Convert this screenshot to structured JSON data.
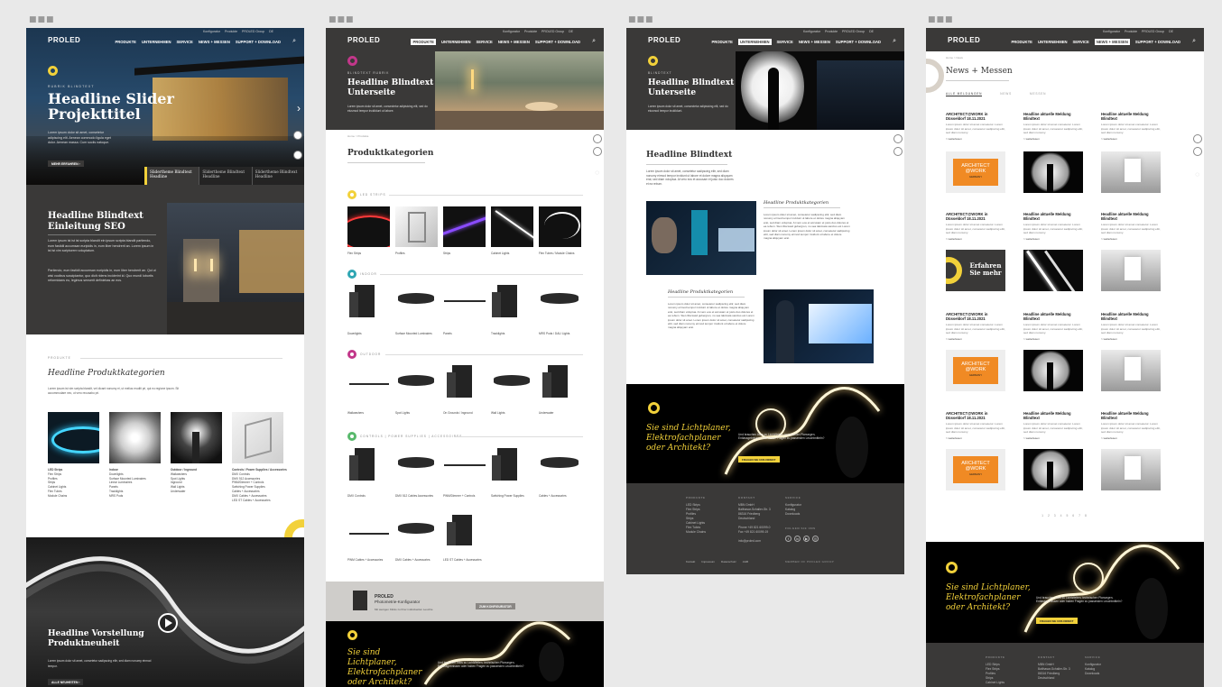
{
  "nav": {
    "logo": "PROLED",
    "util": [
      "Konfigurator",
      "Produkte",
      "PROLED Group",
      "DE"
    ],
    "menu": [
      "Produkte",
      "Unternehmen",
      "Service",
      "News + Messen",
      "Support + Download"
    ]
  },
  "p1": {
    "kicker": "RUBRIK BLINDTEXT",
    "hero_title": "Headline Slider Projekttitel",
    "hero_text": "Lorem ipsum dolor sit amet, consetetur adipiscing elit. Aenean commodo ligula eget dolor. Aenean massa. Cum sociis natoque.",
    "hero_btn": "MEHR ERFAHREN",
    "slider_tabs": [
      "Slidertheme Blindtext Headline",
      "Slidertheme Blindtext Headline",
      "Slidertheme Blindtext Headline"
    ],
    "seo_title": "Headline Blindtext Einleitung SEO",
    "seo_text1": "Lorem ipsum ist ist ist scripta blandit ein ipsum scripta blandit partiendo, eum fastidii accumsan euripidis in, eum liber hendrerit an. Lorem ipsum in ist ist vim scriptorem voluptatum.",
    "seo_text2": "Partiendo, eum fastidii accumsan euripidis in, eum liber hendrerit an. Qui ut wisi vocibus suscipiantur, quo dicit ridens inciderint id. Quo mundi lobortis reformidans eu, legimus senserit definiebas an eos.",
    "prod_kicker": "PRODUKTE",
    "prod_title": "Headline Produktkategorien",
    "prod_text": "Lorem ipsum ist vim scripta blandit, vel dicant nonumy ei, ut melius eruditi pri, qui eu regione ipsum. Sit accommodare nec, ut vero recusabo pri.",
    "cats": [
      {
        "name": "LED Strips",
        "items": [
          "Flex Strips",
          "Profiles",
          "Strips",
          "Cabinet Lights",
          "Flex Tubes",
          "Module Chains"
        ]
      },
      {
        "name": "Indoor",
        "items": [
          "Downlights",
          "Surface Mounted Luminaires",
          "Linear Luminaires",
          "Panels",
          "Tracklights",
          "MRS Pods"
        ]
      },
      {
        "name": "Outdoor / Inground",
        "items": [
          "Wallwashers",
          "Spot Lights",
          "Inground",
          "Wall Lights",
          "Underwater"
        ]
      },
      {
        "name": "Controls / Power Supplies / Accessories",
        "items": [
          "DMX Controls",
          "DMX 512 Accessories",
          "PWM/Dimmer + Controls",
          "Switching Power Supplies",
          "Cables + Accessories",
          "DMX Cables + Accessories",
          "LED ST Cables + Accessories"
        ]
      }
    ],
    "novelty_title": "Headline Vorstellung Produktneuheit",
    "novelty_text": "Lorem ipsum dolor sit amet, consetetur sadipscing elitr, sed diam nonumy eirmod tempor.",
    "novelty_btn": "ALLE NEUHEITEN"
  },
  "p2": {
    "kicker": "BLINDTEXT RUBRIK",
    "hero_title": "Headline Blindtext Unterseite",
    "hero_text": "Lorem ipsum dolor sit amet, consectetur adipisicing elit, sed do eiusmod tempor incididunt ut labore.",
    "breadcrumb": "Home > Produkte",
    "page_title": "Produktkategorien",
    "sections": [
      {
        "label": "LED STRIPS",
        "color": "#f2d13a",
        "items": [
          "Flex Strips",
          "Profiles",
          "Strips",
          "Cabinet Lights",
          "Flex Tubes / Module Chains"
        ]
      },
      {
        "label": "INDOOR",
        "color": "#2fa6b3",
        "items": [
          "Downlights",
          "Surface Mounted Luminaires",
          "Panels",
          "Tracklights",
          "MRS Pods / DALI Lights"
        ]
      },
      {
        "label": "OUTDOOR",
        "color": "#c2378a",
        "items": [
          "Wallwashers",
          "Spot Lights",
          "On Grounds / Inground",
          "Wall Lights",
          "Underwater"
        ]
      },
      {
        "label": "CONTROLS | POWER SUPPLIES | ACCESSOIRES",
        "color": "#58b96c",
        "items": [
          "DMX Controls",
          "DMX 512 Cables Accessories",
          "PWM/Dimmer + Controls",
          "Switching Power Supplies",
          "Cables + Accessories",
          "PWM Cables + Accessories",
          "DMX Cables + Accessories",
          "LED ST Cables + Accessories"
        ]
      }
    ],
    "config_logo": "PROLED",
    "config_title": "Photometrie-Konfigurator",
    "config_text": "Mit wenigen Klicks zu Ihrer individuellen Leuchte",
    "config_btn": "ZUM KONFIGURATOR",
    "cta_title": "Sie sind Lichtplaner, Elektrofachplaner oder Architekt?",
    "cta_text": "Und brauchen Infos zu LichtWelten, technischen Planungen, Entlassgebnissen oder haben Fragen zu passenden Leuchtmitteln?"
  },
  "p3": {
    "kicker": "BLINDTEXT",
    "hero_title": "Headline Blindtext Unterseite",
    "hero_text": "Lorem ipsum dolor sit amet, consectetur adipisicing elit, sed do eiusmod tempor incididunt.",
    "page_title": "Headline Blindtext",
    "intro": "Lorem ipsum dolor sit amet, consetetur sadipscing elitr, sed diam nonumy eirmod tempor invidunt ut labore et dolore magna aliquyam erat, sed diam voluptua. At vero eos et accusam et justo duo dolores et ea rebum.",
    "sub1": "Headline Produktkategorien",
    "sub2": "Headline Produktkategorien",
    "para": "Lorem ipsum dolor sit amet, consetetur sadipscing elitr, sed diam nonumy eirmod tempor invidunt ut labore et dolore magna aliquyam erat, sed diam voluptua. At vero eos et accusam et justo duo dolores et ea rebum. Stet clita kasd gubergren, no sea takimata sanctus est Lorem ipsum dolor sit amet. Lorem ipsum dolor sit amet, consetetur sadipscing elitr, sed diam nonumy eirmod tempor invidunt ut labore et dolore magna aliquyam erat.",
    "cta_title": "Sie sind Lichtplaner, Elektrofachplaner oder Architekt?",
    "cta_text": "Und brauchen Infos zu LichtWelten, technischen Planungen, Entlassgebnissen oder haben Fragen zu passenden Leuchtmitteln?",
    "cta_btn": "FRAGEN SIE UNS DIREKT",
    "footer": {
      "c1_head": "PRODUKTE",
      "c1": [
        "LED Strips",
        "Flex Strips",
        "Profiles",
        "Strips",
        "Cabinet Lights",
        "Flex Tubes",
        "Module Chains"
      ],
      "c2_head": "KONTAKT",
      "c2": [
        "MBN GmbH",
        "Balthasar-Schaller-Str. 3",
        "86316 Friedberg",
        "Deutschland",
        "",
        "Phone +49 821 60099-0",
        "Fax +49 821 60099-19",
        "",
        "info@proled.com"
      ],
      "c3_head": "SERVICE",
      "c3": [
        "Konfigurator",
        "Katalog",
        "Downloads"
      ],
      "follow": "FOLGEN SIE UNS",
      "legal": [
        "Kontakt",
        "Impressum",
        "Datenschutz",
        "AGB"
      ],
      "member": "MEMBER OF PROLED GROUP"
    }
  },
  "p4": {
    "breadcrumb": "Home > News",
    "page_title": "News + Messen",
    "tabs": [
      "ALLE MELDUNGEN",
      "NEWS",
      "MESSEN"
    ],
    "card_title_a": "ARCHITECT@WORK in Düsseldorf 18.11.2021",
    "card_title_b": "Headline aktuelle Meldung Blindtext",
    "card_text": "Lorem ipsum dolor sit amet consetetur. Lorem ipsum dolor sit amet, consetetur sadipscing elitr, sed diam nonumy.",
    "more": "> weiterlesen",
    "aw1": "ARCHITECT",
    "aw2": "@WORK",
    "aw3": "GERMANY",
    "promo": "Erfahren Sie mehr",
    "pagination": "1 2 3 4 5 6 7 8",
    "cta_title": "Sie sind Lichtplaner, Elektrofachplaner oder Architekt?",
    "cta_text": "Und brauchen Infos zu LichtWelten, technischen Planungen, Entlassgebnissen oder haben Fragen zu passenden Leuchtmitteln?",
    "cta_btn": "FRAGEN SIE UNS DIREKT",
    "footer_heads": [
      "PRODUKTE",
      "KONTAKT",
      "SERVICE"
    ],
    "footer_c1": [
      "LED Strips",
      "Flex Strips",
      "Profiles",
      "Strips",
      "Cabinet Lights"
    ],
    "footer_c2": [
      "MBN GmbH",
      "Balthasar-Schaller-Str. 3",
      "86316 Friedberg",
      "Deutschland"
    ],
    "footer_c3": [
      "Konfigurator",
      "Katalog",
      "Downloads"
    ]
  },
  "colors": {
    "dark": "#3a3938",
    "yellow": "#f2d13a",
    "orange": "#f08a24"
  }
}
